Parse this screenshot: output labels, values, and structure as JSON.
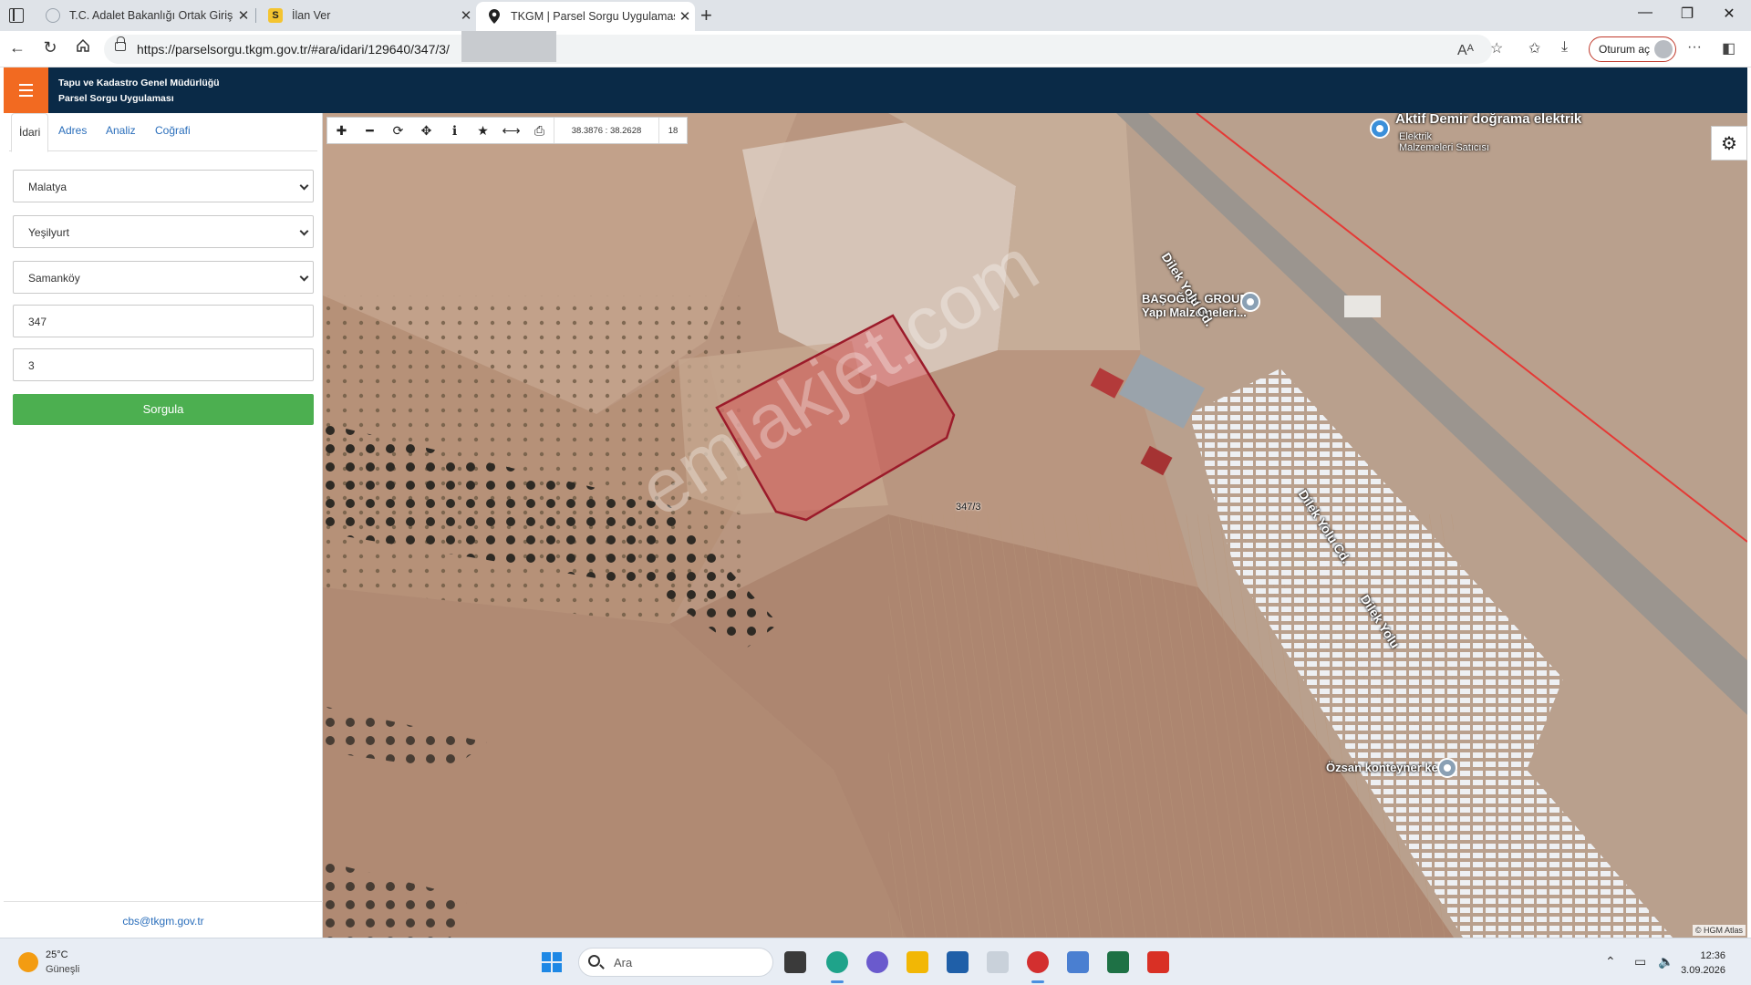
{
  "browser": {
    "tabs": [
      {
        "title": "T.C. Adalet Bakanlığı Ortak Giriş U",
        "favicon": "globe-icon"
      },
      {
        "title": "İlan Ver",
        "favicon": "s-letter-icon",
        "favicon_text": "S"
      },
      {
        "title": "TKGM | Parsel Sorgu Uygulaması",
        "favicon": "map-pin-icon",
        "active": true
      }
    ],
    "url": "https://parselsorgu.tkgm.gov.tr/#ara/idari/129640/347/3/",
    "signin_label": "Oturum aç",
    "read_aloud_label": "Aᴬ"
  },
  "app": {
    "title_line1": "Tapu ve Kadastro Genel Müdürlüğü",
    "title_line2": "Parsel Sorgu Uygulaması",
    "accent_color": "#f26a21",
    "header_color": "#0a2a47"
  },
  "panel": {
    "tabs": [
      "İdari",
      "Adres",
      "Analiz",
      "Coğrafi"
    ],
    "province": "Malatya",
    "district": "Yeşilyurt",
    "neighborhood": "Samanköy",
    "block": "347",
    "parcel": "3",
    "query_button": "Sorgula",
    "footer_email": "cbs@tkgm.gov.tr",
    "button_color": "#4caf50"
  },
  "map": {
    "coordinates": "38.3876 : 38.2628",
    "zoom": "18",
    "parcel_label": "347/3",
    "watermark": "emlakjet.com",
    "attribution": "© HGM Atlas",
    "places": {
      "aktif_name": "Aktif Demir doğrama elektrik",
      "aktif_sub_1": "Elektrik",
      "aktif_sub_2": "Malzemeleri Satıcısı",
      "basogul_1": "BAŞOĞUL GROUP",
      "basogul_2": "Yapı Malzemeleri...",
      "ozsan": "Özsan konteyner kent",
      "road": "Dilek Yolu Cd.",
      "road_2": "Dilek Yolu"
    }
  },
  "taskbar": {
    "temperature": "25°C",
    "weather": "Güneşli",
    "search_placeholder": "Ara",
    "time": "12:36",
    "date": "3.09.2026"
  }
}
